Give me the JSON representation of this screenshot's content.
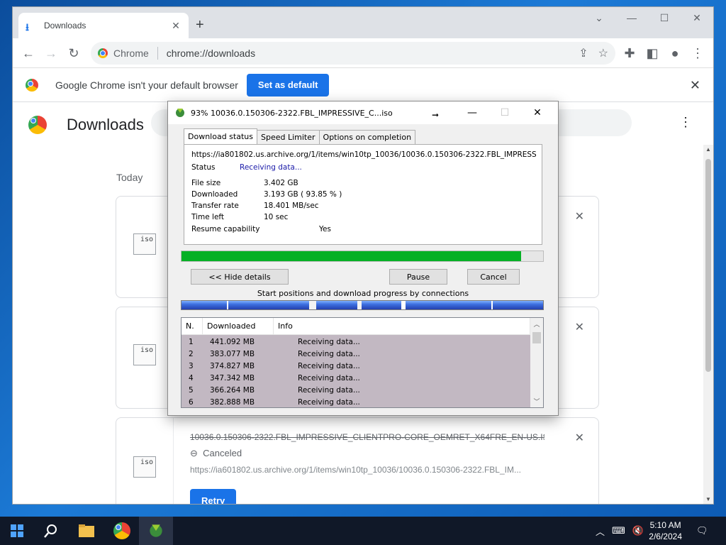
{
  "browser": {
    "tab_title": "Downloads",
    "site_chip": "Chrome",
    "url": "chrome://downloads",
    "infobar_message": "Google Chrome isn't your default browser",
    "infobar_button": "Set as default"
  },
  "downloads_page": {
    "title": "Downloads",
    "section": "Today",
    "file_icon_label": "iso",
    "item3": {
      "filename": "10036.0.150306-2322.FBL_IMPRESSIVE_CLIENTPRO-CORE_OEMRET_X64FRE_EN-US.IS",
      "status": "Canceled",
      "url": "https://ia601802.us.archive.org/1/items/win10tp_10036/10036.0.150306-2322.FBL_IM...",
      "retry_label": "Retry"
    }
  },
  "idm": {
    "title": "93% 10036.0.150306-2322.FBL_IMPRESSIVE_C...iso",
    "tabs": [
      "Download status",
      "Speed Limiter",
      "Options on completion"
    ],
    "url": "https://ia801802.us.archive.org/1/items/win10tp_10036/10036.0.150306-2322.FBL_IMPRESSIVE_C",
    "status_label": "Status",
    "status_value": "Receiving data...",
    "file_size_label": "File size",
    "file_size": "3.402  GB",
    "downloaded_label": "Downloaded",
    "downloaded": "3.193  GB  ( 93.85 % )",
    "transfer_rate_label": "Transfer rate",
    "transfer_rate": "18.401  MB/sec",
    "time_left_label": "Time left",
    "time_left": "10 sec",
    "resume_label": "Resume capability",
    "resume_value": "Yes",
    "progress_fraction": 0.9385,
    "hide_details": "<< Hide details",
    "pause": "Pause",
    "cancel": "Cancel",
    "connections_label": "Start positions and download progress by connections",
    "table_headers": [
      "N.",
      "Downloaded",
      "Info"
    ],
    "connections": [
      {
        "n": "1",
        "downloaded": "441.092  MB",
        "info": "Receiving data..."
      },
      {
        "n": "2",
        "downloaded": "383.077  MB",
        "info": "Receiving data..."
      },
      {
        "n": "3",
        "downloaded": "374.827  MB",
        "info": "Receiving data..."
      },
      {
        "n": "4",
        "downloaded": "347.342  MB",
        "info": "Receiving data..."
      },
      {
        "n": "5",
        "downloaded": "366.264  MB",
        "info": "Receiving data..."
      },
      {
        "n": "6",
        "downloaded": "382.888  MB",
        "info": "Receiving data..."
      }
    ]
  },
  "taskbar": {
    "time": "5:10 AM",
    "date": "2/6/2024"
  },
  "colors": {
    "chrome_blue": "#1a73e8",
    "idm_progress_green": "#06b025"
  }
}
